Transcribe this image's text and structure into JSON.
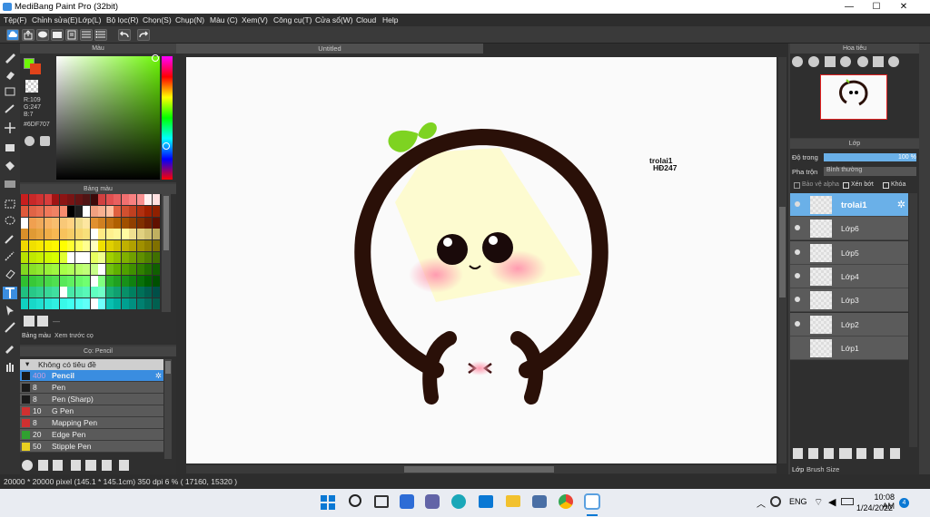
{
  "window": {
    "title": "MediBang Paint Pro (32bit)",
    "minimize": "—",
    "maximize": "☐",
    "close": "✕"
  },
  "menu": [
    "Tệp(F)",
    "Chỉnh sửa(E)",
    "Lớp(L)",
    "Bộ lọc(R)",
    "Chọn(S)",
    "Chụp(N)",
    "Màu (C)",
    "Xem(V)",
    "Công cụ(T)",
    "Cửa sổ(W)",
    "Cloud",
    "Help"
  ],
  "color_panel": {
    "title": "Màu",
    "r": "R:109",
    "g": "G:247",
    "b": "B:7",
    "hex": "#6DF707",
    "primary_color": "#6DF707",
    "secondary_color": "#E0431A"
  },
  "palette_panel": {
    "title": "Bảng màu",
    "tab1": "Bảng màu",
    "tab2": "Xem trước cọ",
    "more": "—"
  },
  "brush_panel": {
    "title": "Cọ: Pencil",
    "group": "Không có tiêu đề",
    "items": [
      {
        "size": "400",
        "name": "Pencil",
        "color": "#1a1a1a",
        "selected": true
      },
      {
        "size": "8",
        "name": "Pen",
        "color": "#1a1a1a"
      },
      {
        "size": "8",
        "name": "Pen (Sharp)",
        "color": "#1a1a1a"
      },
      {
        "size": "10",
        "name": "G Pen",
        "color": "#d03030"
      },
      {
        "size": "8",
        "name": "Mapping Pen",
        "color": "#d03030"
      },
      {
        "size": "20",
        "name": "Edge Pen",
        "color": "#30a030"
      },
      {
        "size": "50",
        "name": "Stipple Pen",
        "color": "#e8d020"
      }
    ]
  },
  "canvas": {
    "tab": "Untitled",
    "watermark_line1": "trolai1",
    "watermark_line2": "HĐ247"
  },
  "navigator": {
    "title": "Hoa tiêu"
  },
  "layer_panel": {
    "title": "Lớp",
    "opacity_label": "Độ trong",
    "opacity_value": "100 %",
    "opacity": 1.0,
    "blend_label": "Pha trộn",
    "blend_value": "Bình thường",
    "alpha_protect": "Bảo vệ alpha",
    "clip": "Xén bớt",
    "lock": "Khóa",
    "layers": [
      "trolai1",
      "Lớp6",
      "Lớp5",
      "Lớp4",
      "Lớp3",
      "Lớp2",
      "Lớp1"
    ],
    "footer_tab1": "Lớp",
    "footer_tab2": "Brush Size"
  },
  "status": {
    "text": "20000 * 20000 pixel   (145.1 * 145.1cm)   350 dpi   6 %   ( 17160, 15320 )"
  },
  "taskbar": {
    "lang": "ENG",
    "time": "10:08 AM",
    "date": "1/24/2022",
    "notif": "4"
  }
}
